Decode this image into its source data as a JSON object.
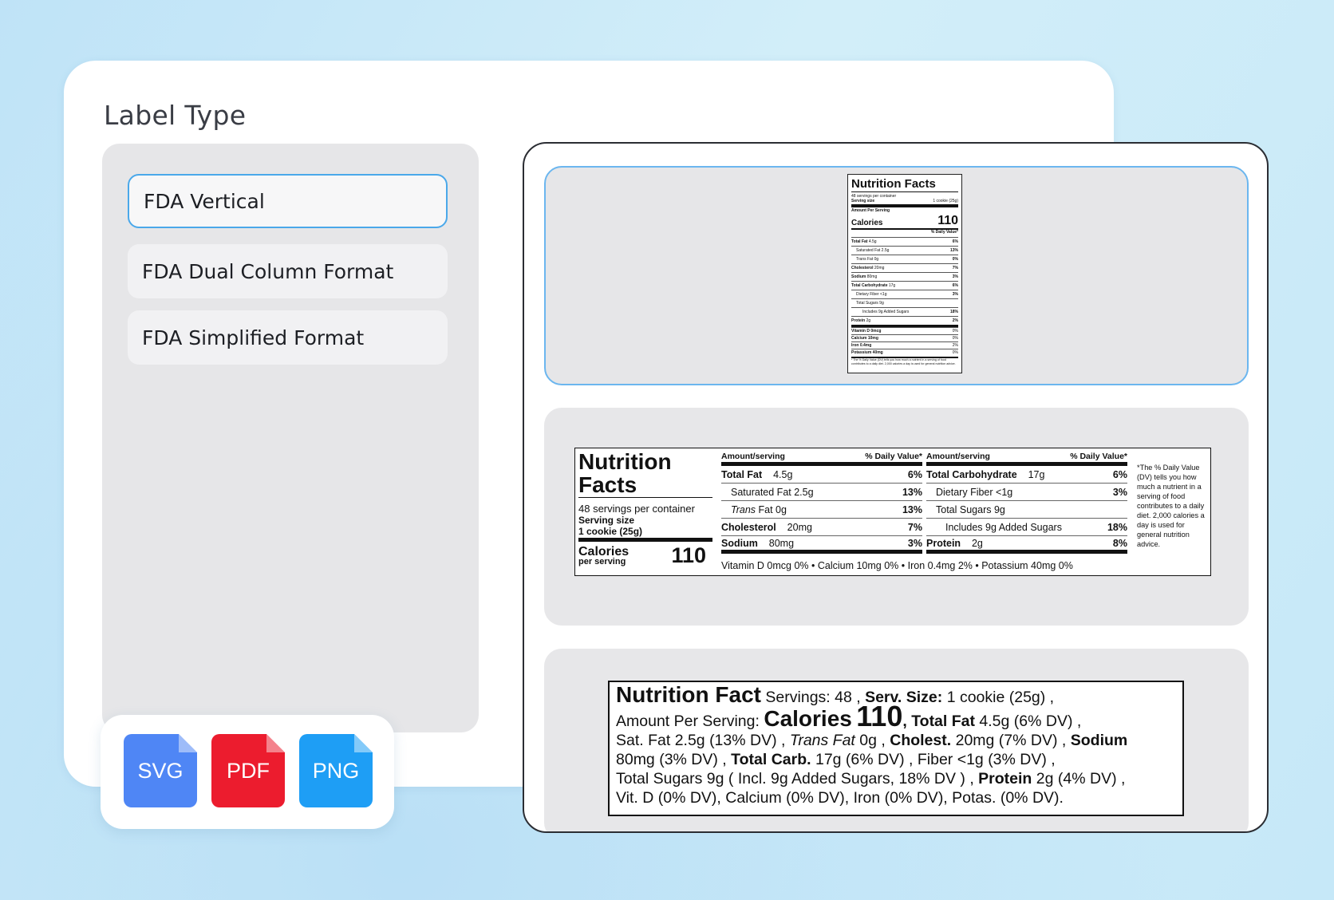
{
  "panel": {
    "title": "Label Type",
    "options": [
      "FDA Vertical",
      "FDA Dual Column Format",
      "FDA Simplified Format"
    ],
    "selected": "FDA Vertical"
  },
  "formats": [
    "SVG",
    "PDF",
    "PNG"
  ],
  "colors": {
    "svg": "#4f86f5",
    "pdf": "#ec1c2e",
    "png": "#1e9ef5",
    "accent": "#4aa8ea"
  },
  "vertical": {
    "title": "Nutrition Facts",
    "servings": "48 servings per container",
    "serving_label": "Serving size",
    "serving_value": "1 cookie (25g)",
    "amount": "Amount Per Serving",
    "calories_label": "Calories",
    "calories_value": "110",
    "dv": "% Daily Value*",
    "rows": [
      [
        "Total Fat",
        "4.5g",
        "6%"
      ],
      [
        "Saturated Fat 2.5g",
        "",
        "13%"
      ],
      [
        "Trans Fat 0g",
        "",
        "0%"
      ],
      [
        "Cholesterol",
        "20mg",
        "7%"
      ],
      [
        "Sodium",
        "80mg",
        "3%"
      ],
      [
        "Total Carbohydrate",
        "17g",
        "6%"
      ],
      [
        "Dietary Fiber <1g",
        "",
        "3%"
      ],
      [
        "Total Sugars 9g",
        "",
        ""
      ],
      [
        "Includes 9g Added Sugars",
        "",
        "18%"
      ],
      [
        "Protein",
        "2g",
        "2%"
      ]
    ],
    "vitamins": [
      [
        "Vitamin D 0mcg",
        "0%"
      ],
      [
        "Calcium 10mg",
        "0%"
      ],
      [
        "Iron 0.4mg",
        "2%"
      ],
      [
        "Potassium 40mg",
        "0%"
      ]
    ],
    "footnote": "* The % Daily Value (DV) tells you how much a nutrient in a serving of food contributes to a daily diet. 2,000 calories a day is used for general nutrition advice."
  },
  "dual": {
    "title_line1": "Nutrition",
    "title_line2": "Facts",
    "servings": "48 servings per container",
    "serving_label": "Serving size",
    "serving_value": "1 cookie (25g)",
    "calories_label": "Calories",
    "calories_sub": "per serving",
    "calories_value": "110",
    "hdr_amount": "Amount/serving",
    "hdr_dv": "% Daily Value*",
    "col1": [
      {
        "name": "Total Fat",
        "amt": "4.5g",
        "dv": "6%"
      },
      {
        "name": "Saturated Fat 2.5g",
        "amt": "",
        "dv": "13%"
      },
      {
        "name": "Trans",
        "amt": "Fat 0g",
        "dv": "13%"
      },
      {
        "name": "Cholesterol",
        "amt": "20mg",
        "dv": "7%"
      },
      {
        "name": "Sodium",
        "amt": "80mg",
        "dv": "3%"
      }
    ],
    "col2": [
      {
        "name": "Total Carbohydrate",
        "amt": "17g",
        "dv": "6%"
      },
      {
        "name": "Dietary Fiber <1g",
        "amt": "",
        "dv": "3%"
      },
      {
        "name": "Total Sugars 9g",
        "amt": "",
        "dv": ""
      },
      {
        "name": "Includes 9g Added Sugars",
        "amt": "",
        "dv": "18%"
      },
      {
        "name": "Protein",
        "amt": "2g",
        "dv": "8%"
      }
    ],
    "vitamins": "Vitamin D 0mcg 0% • Calcium 10mg 0% • Iron 0.4mg 2% • Potassium 40mg 0%",
    "note": "*The % Daily Value (DV) tells you how much a nutrient in a serving of food contributes to a daily diet. 2,000 calories a day is used for general nutrition advice."
  },
  "simple": {
    "title": "Nutrition Fact",
    "servings": "Servings: 48 ,",
    "serv_size_label": "Serv. Size:",
    "serv_size_value": "1 cookie (25g) ,",
    "amount": "Amount Per Serving:",
    "calories_label": "Calories",
    "calories_value": "110",
    "total_fat_label": "Total Fat",
    "total_fat_value": "4.5g (6% DV) ,",
    "sat_fat": "Sat. Fat 2.5g (13% DV) ,",
    "trans_label": "Trans Fat",
    "trans_value": "0g ,",
    "cholest_label": "Cholest.",
    "cholest_value": "20mg (7% DV) ,",
    "sodium_label": "Sodium",
    "sodium_value": "80mg (3% DV) ,",
    "carb_label": "Total Carb.",
    "carb_value": "17g (6% DV) , Fiber <1g (3% DV) ,",
    "sugars": "Total Sugars 9g ( Incl. 9g Added Sugars, 18% DV ) ,",
    "protein_label": "Protein",
    "protein_value": "2g (4% DV) ,",
    "vitamins": "Vit. D (0% DV), Calcium (0% DV), Iron (0% DV), Potas. (0% DV)."
  }
}
